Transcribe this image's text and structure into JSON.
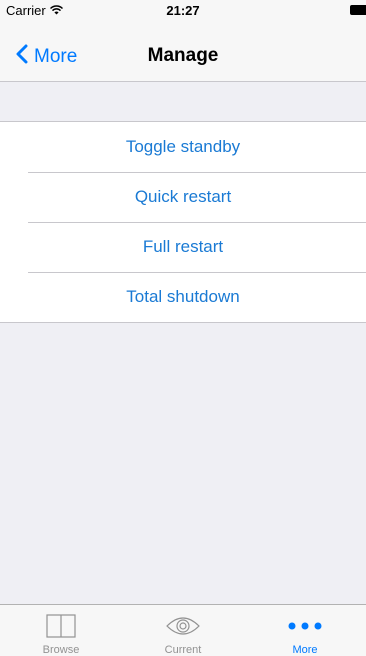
{
  "status_bar": {
    "carrier": "Carrier",
    "time": "21:27"
  },
  "nav": {
    "back_label": "More",
    "title": "Manage"
  },
  "actions": [
    {
      "label": "Toggle standby"
    },
    {
      "label": "Quick restart"
    },
    {
      "label": "Full restart"
    },
    {
      "label": "Total shutdown"
    }
  ],
  "tab_bar": {
    "tabs": [
      {
        "label": "Browse",
        "icon": "book-icon",
        "active": false
      },
      {
        "label": "Current",
        "icon": "eye-icon",
        "active": false
      },
      {
        "label": "More",
        "icon": "more-dots-icon",
        "active": true
      }
    ]
  },
  "colors": {
    "accent": "#007aff",
    "action_text": "#1a7ad4",
    "background": "#efeff4",
    "inactive_tab": "#929292"
  }
}
